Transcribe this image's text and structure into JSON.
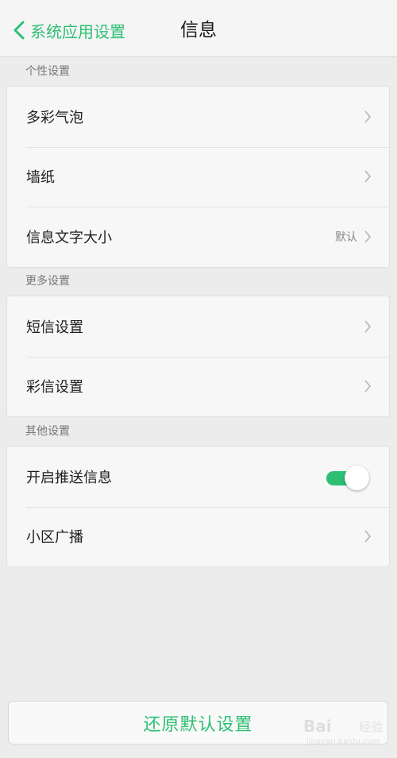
{
  "header": {
    "back_label": "系统应用设置",
    "title": "信息"
  },
  "sections": [
    {
      "label": "个性设置",
      "rows": [
        {
          "label": "多彩气泡"
        },
        {
          "label": "墙纸"
        },
        {
          "label": "信息文字大小",
          "value": "默认"
        }
      ]
    },
    {
      "label": "更多设置",
      "rows": [
        {
          "label": "短信设置"
        },
        {
          "label": "彩信设置"
        }
      ]
    },
    {
      "label": "其他设置",
      "rows": [
        {
          "label": "开启推送信息",
          "toggle_on": true
        },
        {
          "label": "小区广播"
        }
      ]
    }
  ],
  "reset_button_label": "还原默认设置",
  "watermark": {
    "brand": "Bai",
    "sub": "经验",
    "url": "jingyan.baidu.com"
  },
  "colors": {
    "accent": "#2dbf72",
    "background": "#ececec",
    "card": "#f7f7f7"
  },
  "icons": {
    "back": "chevron-left-icon",
    "row": "chevron-right-icon"
  }
}
